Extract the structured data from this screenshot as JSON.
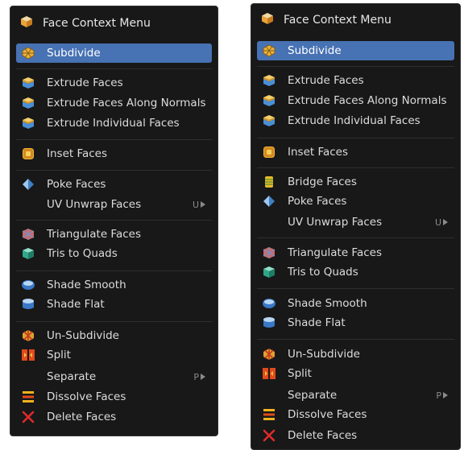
{
  "left_menu": {
    "title": "Face Context Menu",
    "items": [
      {
        "label": "Subdivide",
        "icon": "subdivide-icon",
        "active": true
      },
      {
        "label": "Extrude Faces",
        "icon": "extrude-icon"
      },
      {
        "label": "Extrude Faces Along Normals",
        "icon": "extrude-icon"
      },
      {
        "label": "Extrude Individual Faces",
        "icon": "extrude-icon"
      },
      {
        "label": "Inset Faces",
        "icon": "inset-icon"
      },
      {
        "label": "Poke Faces",
        "icon": "poke-icon"
      },
      {
        "label": "UV Unwrap Faces",
        "icon": "none",
        "shortcut": "U"
      },
      {
        "label": "Triangulate Faces",
        "icon": "triangulate-icon"
      },
      {
        "label": "Tris to Quads",
        "icon": "tris-to-quads-icon"
      },
      {
        "label": "Shade Smooth",
        "icon": "shade-smooth-icon"
      },
      {
        "label": "Shade Flat",
        "icon": "shade-flat-icon"
      },
      {
        "label": "Un-Subdivide",
        "icon": "un-subdivide-icon"
      },
      {
        "label": "Split",
        "icon": "split-icon"
      },
      {
        "label": "Separate",
        "icon": "none",
        "shortcut": "P"
      },
      {
        "label": "Dissolve Faces",
        "icon": "dissolve-icon"
      },
      {
        "label": "Delete Faces",
        "icon": "delete-icon"
      }
    ]
  },
  "right_menu": {
    "title": "Face Context Menu",
    "items": [
      {
        "label": "Subdivide",
        "icon": "subdivide-icon",
        "active": true
      },
      {
        "label": "Extrude Faces",
        "icon": "extrude-icon"
      },
      {
        "label": "Extrude Faces Along Normals",
        "icon": "extrude-icon"
      },
      {
        "label": "Extrude Individual Faces",
        "icon": "extrude-icon"
      },
      {
        "label": "Inset Faces",
        "icon": "inset-icon"
      },
      {
        "label": "Bridge Faces",
        "icon": "bridge-icon"
      },
      {
        "label": "Poke Faces",
        "icon": "poke-icon"
      },
      {
        "label": "UV Unwrap Faces",
        "icon": "none",
        "shortcut": "U"
      },
      {
        "label": "Triangulate Faces",
        "icon": "triangulate-icon"
      },
      {
        "label": "Tris to Quads",
        "icon": "tris-to-quads-icon"
      },
      {
        "label": "Shade Smooth",
        "icon": "shade-smooth-icon"
      },
      {
        "label": "Shade Flat",
        "icon": "shade-flat-icon"
      },
      {
        "label": "Un-Subdivide",
        "icon": "un-subdivide-icon"
      },
      {
        "label": "Split",
        "icon": "split-icon"
      },
      {
        "label": "Separate",
        "icon": "none",
        "shortcut": "P"
      },
      {
        "label": "Dissolve Faces",
        "icon": "dissolve-icon"
      },
      {
        "label": "Delete Faces",
        "icon": "delete-icon"
      }
    ]
  },
  "colors": {
    "menu_bg": "#181818",
    "active_bg": "#4772b3",
    "text": "#dcdcdc",
    "shortcut": "#8a8a8a"
  }
}
